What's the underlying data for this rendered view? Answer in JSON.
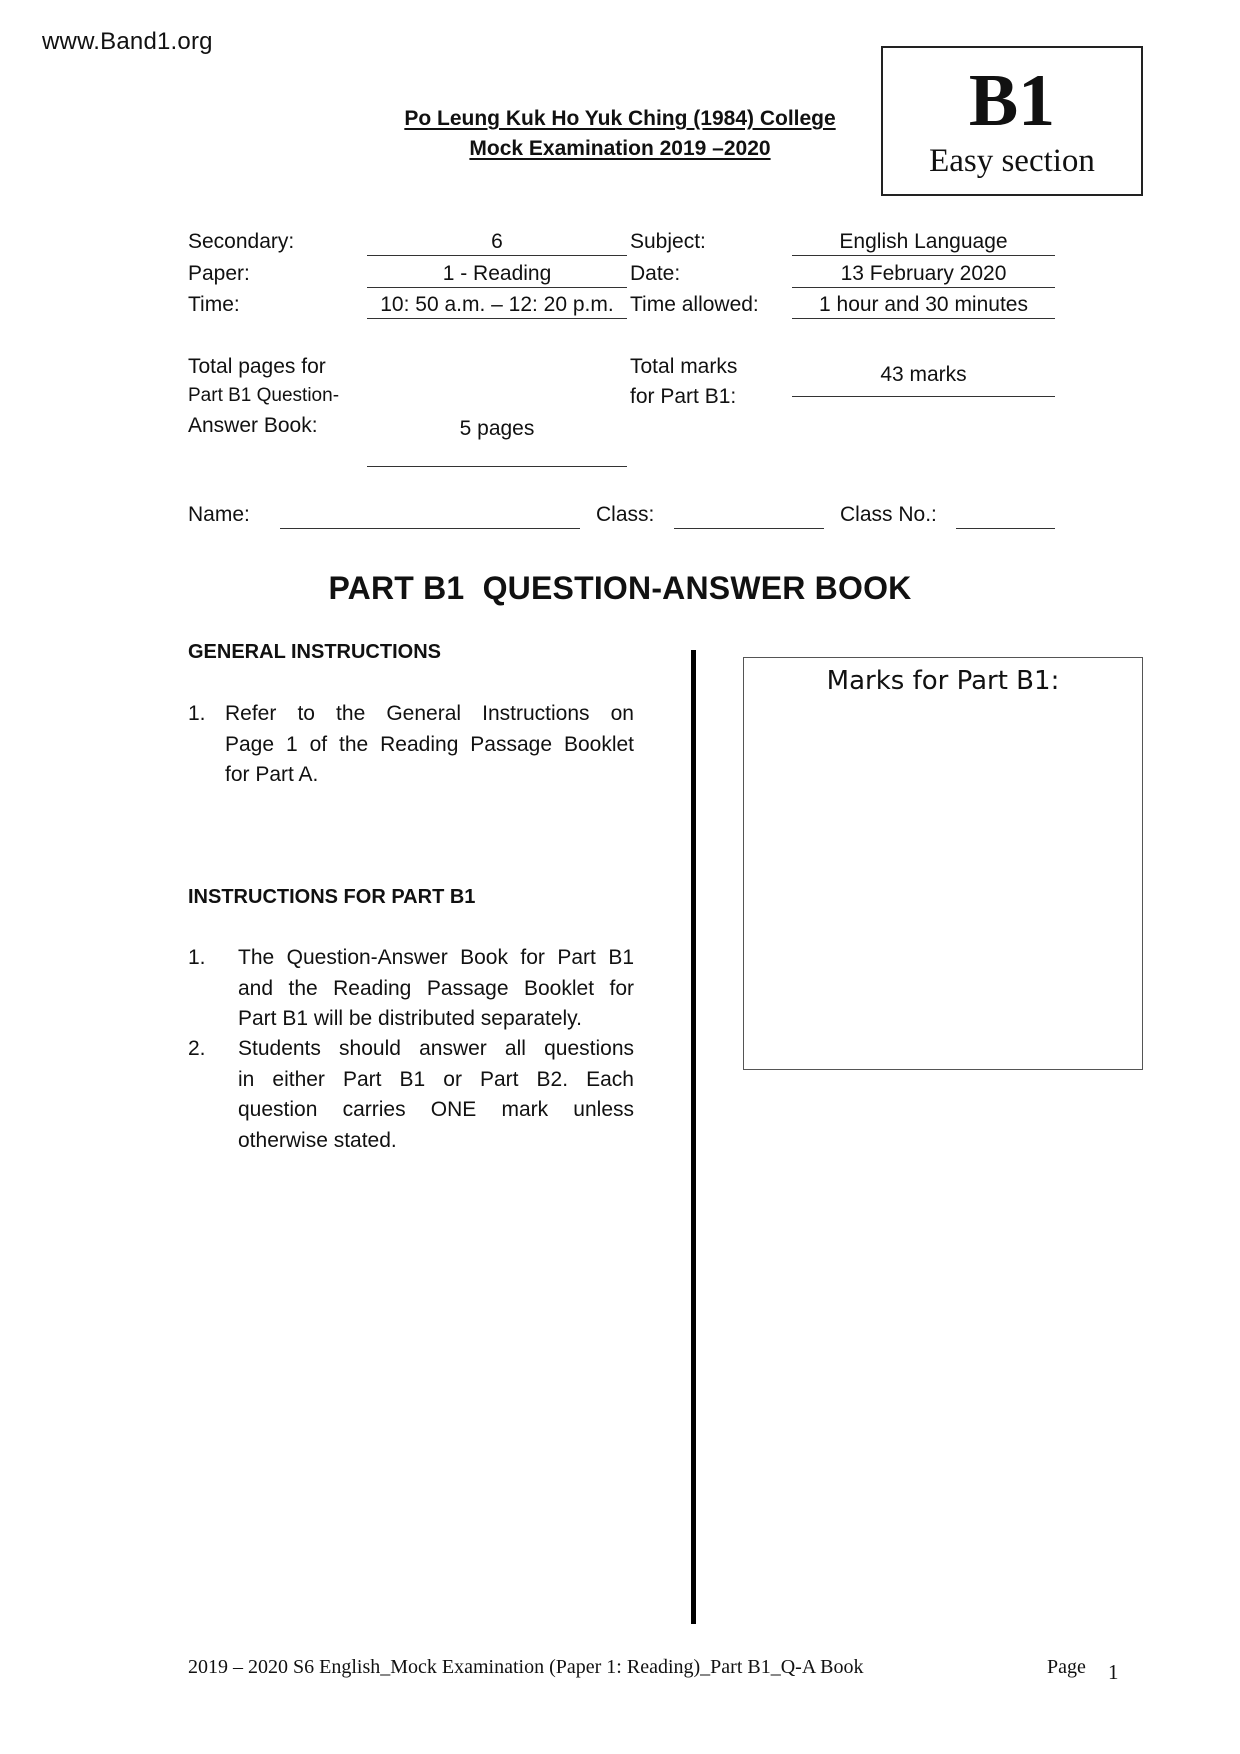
{
  "watermark": "www.Band1.org",
  "header": {
    "school": "Po Leung Kuk Ho Yuk Ching (1984) College",
    "exam": "Mock Examination 2019 –2020"
  },
  "section_box": {
    "code": "B1",
    "label": "Easy section"
  },
  "details": {
    "secondary": {
      "label": "Secondary:",
      "value": "6"
    },
    "paper": {
      "label": "Paper:",
      "value": "1 - Reading"
    },
    "time": {
      "label": "Time:",
      "value": "10: 50 a.m. – 12: 20 p.m."
    },
    "subject": {
      "label": "Subject:",
      "value": "English Language"
    },
    "date": {
      "label": "Date:",
      "value": "13 February 2020"
    },
    "time_allowed": {
      "label": "Time allowed:",
      "value": "1 hour and 30 minutes"
    },
    "total_pages": {
      "label_lines": [
        "Total pages for",
        "Part B1 Question-",
        "Answer Book:"
      ],
      "value": "5 pages"
    },
    "total_marks": {
      "label_lines": [
        "Total marks",
        "for Part B1:"
      ],
      "value": "43 marks"
    }
  },
  "student": {
    "name_label": "Name:",
    "name_value": "",
    "class_label": "Class:",
    "class_value": "",
    "class_no_label": "Class No.:",
    "class_no_value": ""
  },
  "title": "PART B1  QUESTION-ANSWER BOOK",
  "general_instructions": {
    "heading": "GENERAL INSTRUCTIONS",
    "items": [
      {
        "num": "1.",
        "lines": [
          "Refer to the General Instructions on",
          "Page 1 of the Reading Passage Booklet",
          "for Part A."
        ]
      }
    ]
  },
  "part_instructions": {
    "heading": "INSTRUCTIONS FOR PART B1",
    "items": [
      {
        "num": "1.",
        "lines": [
          "The Question-Answer Book for Part B1",
          "and the Reading Passage Booklet for",
          "Part B1 will be distributed separately."
        ]
      },
      {
        "num": "2.",
        "lines": [
          "Students should answer all questions",
          "in either Part B1 or Part B2. Each",
          "question carries ONE mark unless",
          "otherwise stated."
        ]
      }
    ]
  },
  "marks_box": {
    "caption": "Marks for Part B1:",
    "value": ""
  },
  "footer": {
    "text": "2019 – 2020 S6 English_Mock Examination (Paper 1: Reading)_Part B1_Q-A Book",
    "page_label": "Page",
    "page_number": "1"
  }
}
